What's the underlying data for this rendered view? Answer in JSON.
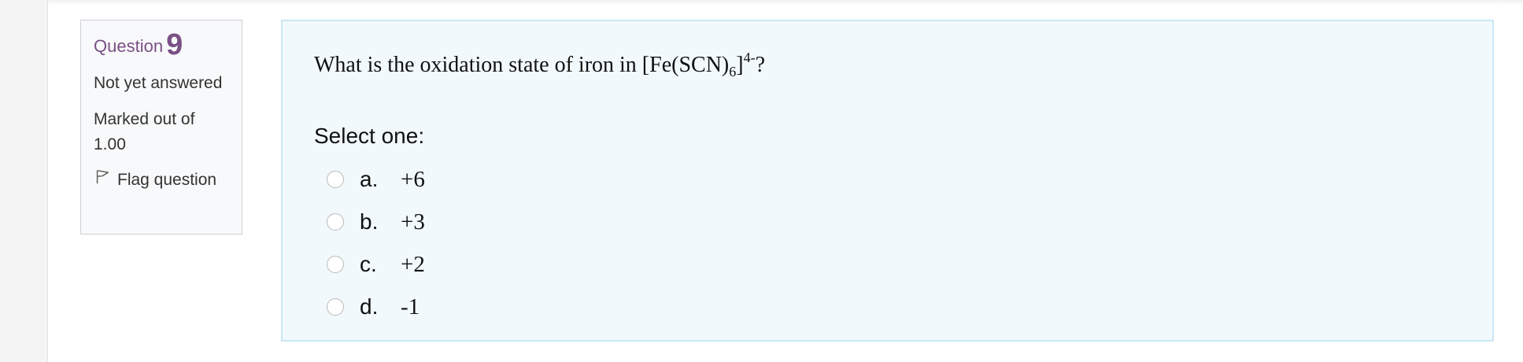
{
  "info": {
    "question_label": "Question",
    "question_number": "9",
    "state": "Not yet answered",
    "grade": "Marked out of 1.00",
    "flag_label": "Flag question"
  },
  "question": {
    "text_before": "What is the oxidation state of iron in [Fe(SCN)",
    "subscript": "6",
    "text_mid": "]",
    "superscript": "4-",
    "text_after": "?",
    "prompt": "Select one:",
    "options": [
      {
        "letter": "a.",
        "text": "+6",
        "selected": false
      },
      {
        "letter": "b.",
        "text": "+3",
        "selected": false
      },
      {
        "letter": "c.",
        "text": "+2",
        "selected": false
      },
      {
        "letter": "d.",
        "text": "-1",
        "selected": false
      }
    ]
  },
  "colors": {
    "accent": "#7a4f86",
    "content_bg": "#f1f9fd",
    "content_border": "#c9e8f4"
  },
  "icons": {
    "flag": "flag-icon"
  }
}
